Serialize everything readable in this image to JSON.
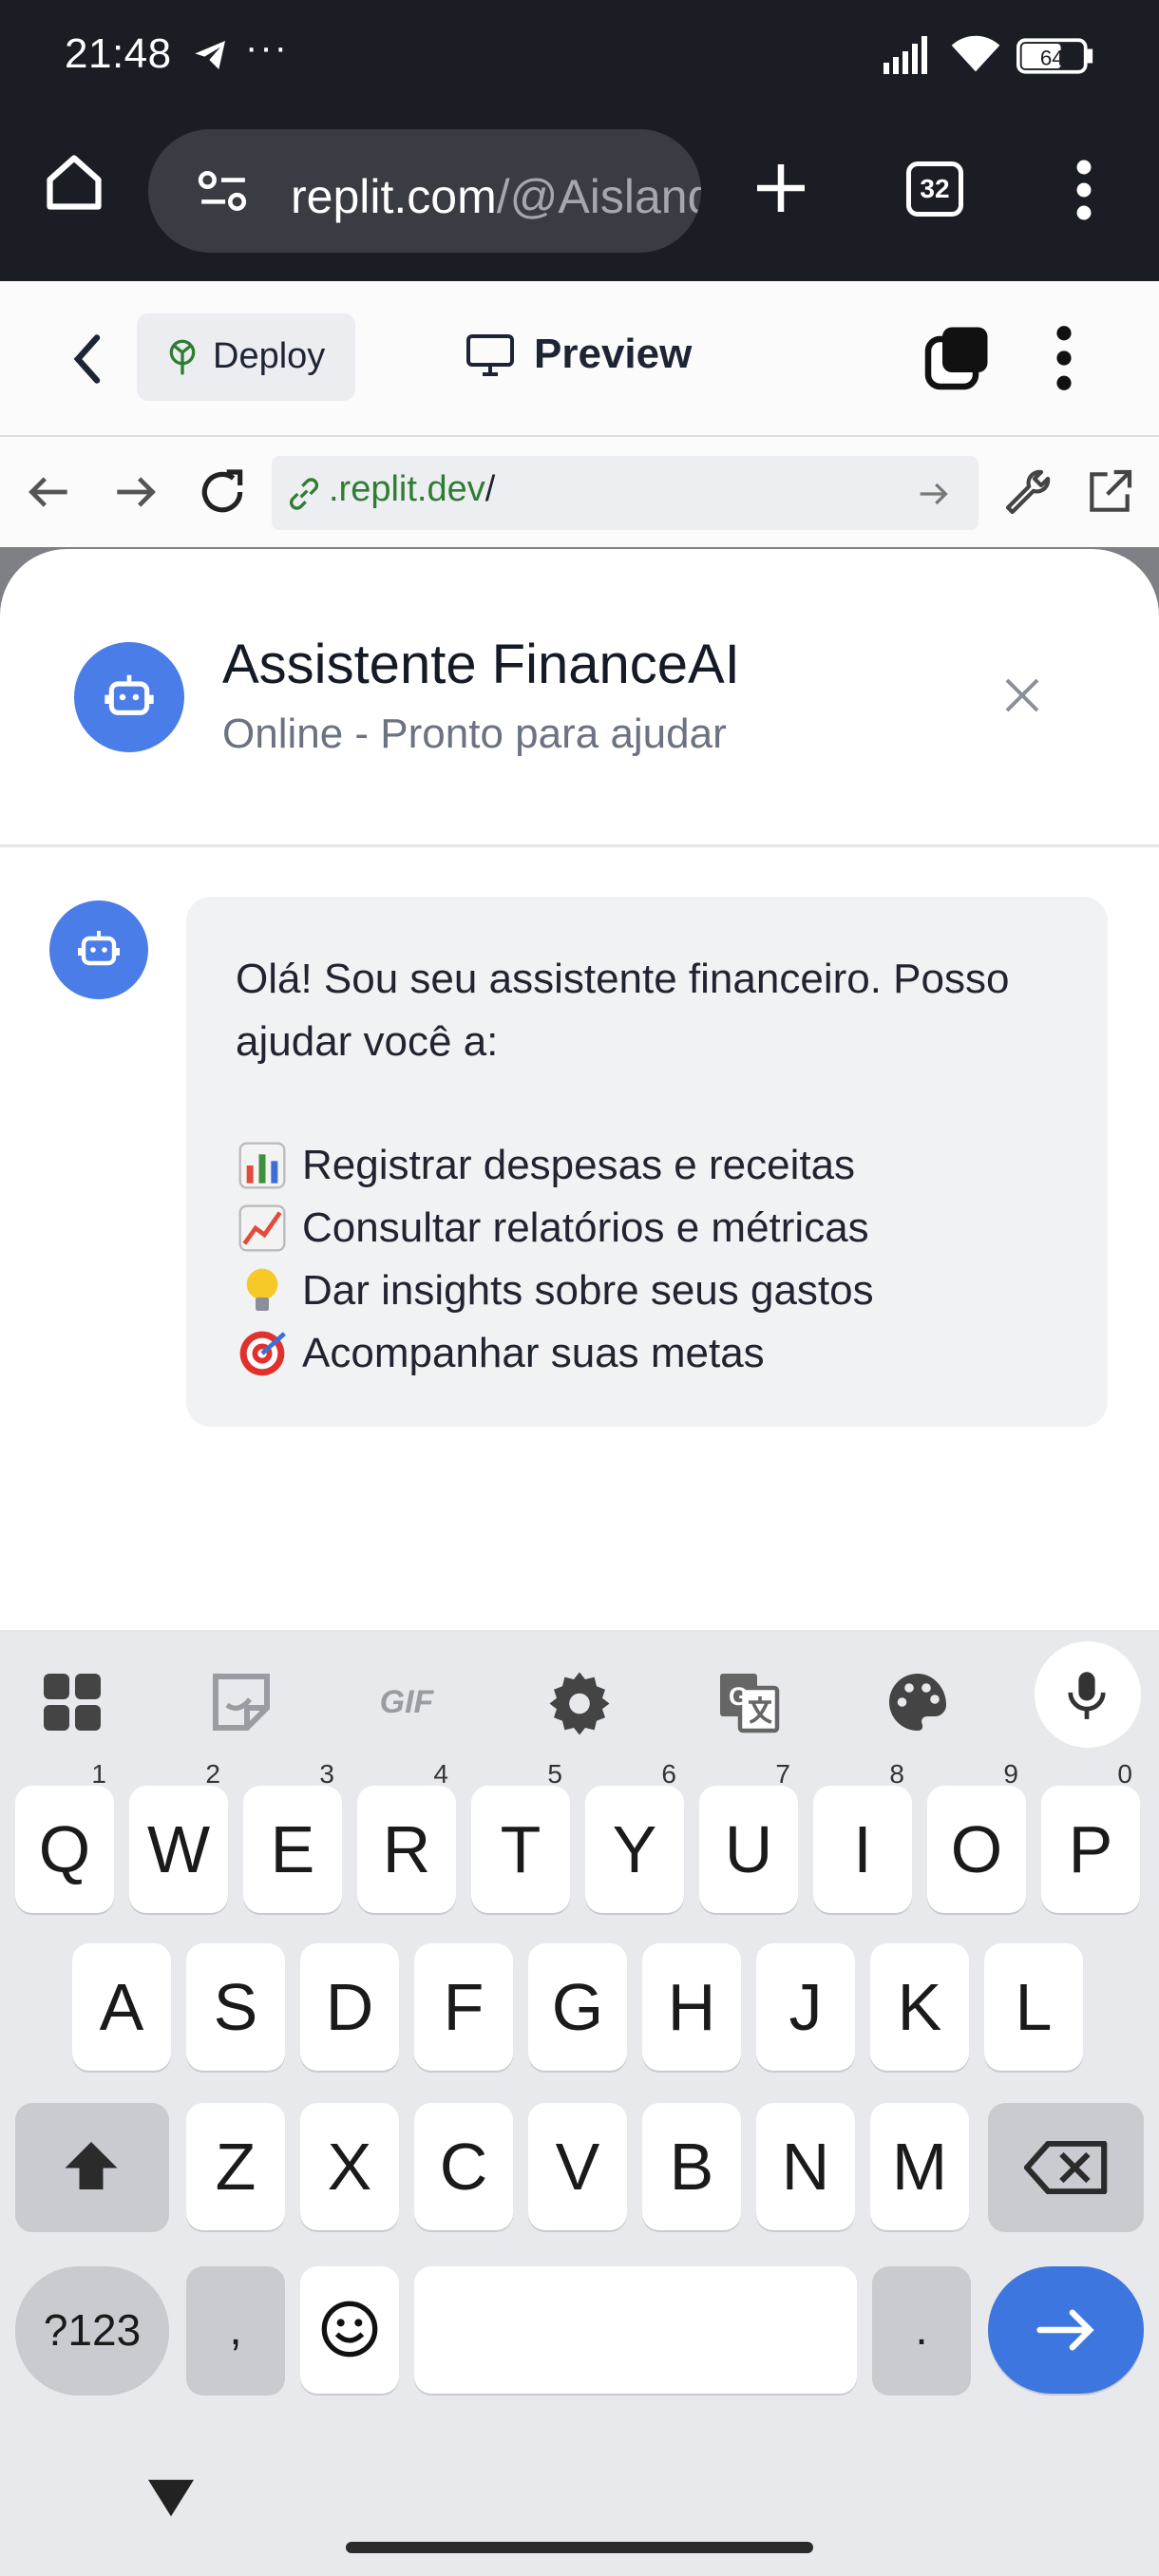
{
  "status_bar": {
    "time": "21:48",
    "overflow": "···",
    "battery": "64"
  },
  "browser": {
    "url_host": "replit.com",
    "url_path": "/@Aisland",
    "tab_count": "32"
  },
  "replit": {
    "deploy_label": "Deploy",
    "preview_label": "Preview",
    "address_host": ".replit.dev",
    "address_slash": "/"
  },
  "chat": {
    "title": "Assistente FinanceAI",
    "subtitle": "Online - Pronto para ajudar",
    "message": {
      "line1": "Olá! Sou seu assistente financeiro. Posso",
      "line2": "ajudar você a:",
      "items": [
        {
          "icon": "bar-chart-emoji",
          "text": "Registrar despesas e receitas"
        },
        {
          "icon": "chart-increasing-emoji",
          "text": "Consultar relatórios e métricas"
        },
        {
          "icon": "light-bulb-emoji",
          "text": "Dar insights sobre seus gastos"
        },
        {
          "icon": "direct-hit-emoji",
          "text": "Acompanhar suas metas"
        }
      ]
    }
  },
  "keyboard": {
    "toolbar": [
      "apps-icon",
      "sticker-icon",
      "GIF",
      "settings-icon",
      "translate-icon",
      "palette-icon",
      "mic-icon"
    ],
    "row1": [
      {
        "k": "Q",
        "h": "1"
      },
      {
        "k": "W",
        "h": "2"
      },
      {
        "k": "E",
        "h": "3"
      },
      {
        "k": "R",
        "h": "4"
      },
      {
        "k": "T",
        "h": "5"
      },
      {
        "k": "Y",
        "h": "6"
      },
      {
        "k": "U",
        "h": "7"
      },
      {
        "k": "I",
        "h": "8"
      },
      {
        "k": "O",
        "h": "9"
      },
      {
        "k": "P",
        "h": "0"
      }
    ],
    "row2": [
      "A",
      "S",
      "D",
      "F",
      "G",
      "H",
      "J",
      "K",
      "L"
    ],
    "row3": [
      "Z",
      "X",
      "C",
      "V",
      "B",
      "N",
      "M"
    ],
    "symbols_label": "?123",
    "comma": ",",
    "period": "."
  }
}
